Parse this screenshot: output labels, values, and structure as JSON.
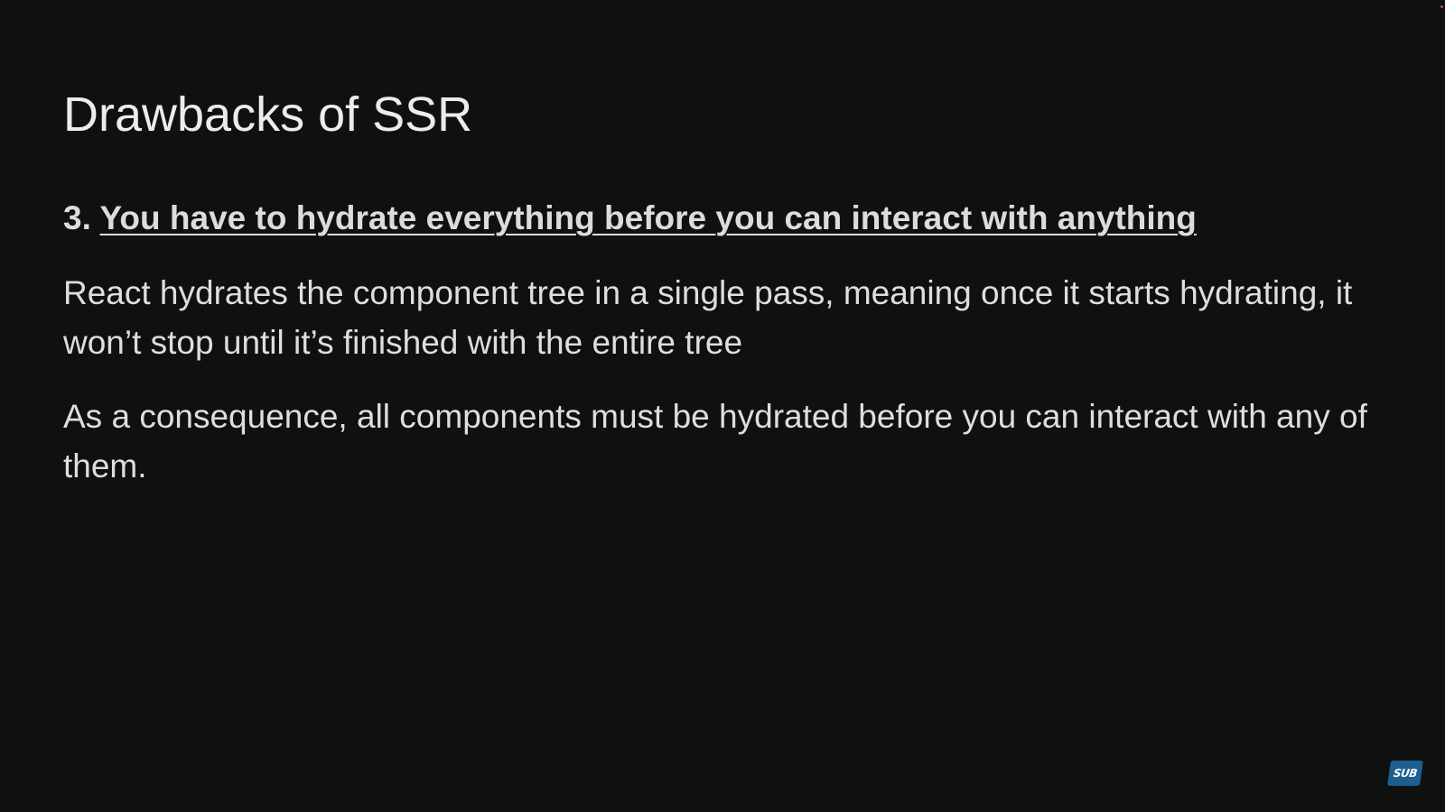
{
  "slide": {
    "title": "Drawbacks of SSR",
    "point_number": "3.",
    "point_text": "You have to hydrate everything before you can interact with anything",
    "paragraphs": [
      "React hydrates the component tree in a single pass, meaning once it starts hydrating, it won’t stop until it’s finished with the entire tree",
      "As a consequence, all components must be hydrated before you can interact with any of them."
    ]
  },
  "overlay": {
    "sub_badge_label": "SUB",
    "sub_badge_color": "#1f5f8f"
  },
  "colors": {
    "background": "#0f1111",
    "text": "#e8e8e8"
  }
}
